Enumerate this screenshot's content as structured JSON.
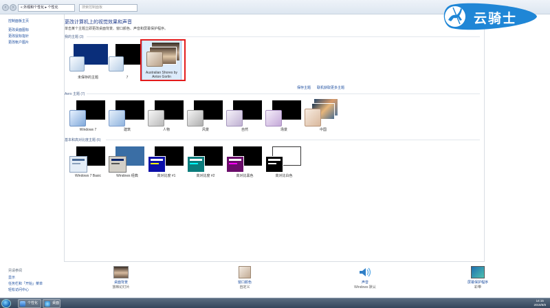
{
  "address": {
    "crumb": "« 外观和个性化 ▸ 个性化",
    "search_placeholder": "搜索控制面板"
  },
  "sidebar": {
    "links": [
      "控制面板主页",
      "更改桌面图标",
      "更改鼠标指针",
      "更改帐户图片"
    ],
    "see_also_title": "另请参阅",
    "see_also": [
      "显示",
      "任务栏和「开始」菜单",
      "轻松访问中心"
    ]
  },
  "main": {
    "title": "更改计算机上的视觉效果和声音",
    "subtitle": "单击某个主题立即更改桌面背景、窗口颜色、声音和屏幕保护程序。",
    "my_themes": {
      "header": "我的主题 (3)",
      "items": [
        "未保存的主题",
        "7",
        "Australian Shores by Anton Gorlin"
      ]
    },
    "save_theme_link": "保存主题",
    "online_link": "联机获取更多主题",
    "aero": {
      "header": "Aero 主题 (7)",
      "items": [
        "Windows 7",
        "建筑",
        "人物",
        "风景",
        "自然",
        "场景",
        "中国"
      ]
    },
    "basic": {
      "header": "基本和高对比度主题 (6)",
      "items": [
        "Windows 7 Basic",
        "Windows 经典",
        "高对比度 #1",
        "高对比度 #2",
        "高对比黑色",
        "高对比白色"
      ]
    }
  },
  "bottom": [
    {
      "label": "桌面背景",
      "value": "放映幻灯片"
    },
    {
      "label": "窗口颜色",
      "value": "自定义"
    },
    {
      "label": "声音",
      "value": "Windows 默认"
    },
    {
      "label": "屏幕保护程序",
      "value": "彩带"
    }
  ],
  "logo_text": "云骑士",
  "taskbar": {
    "items": [
      "个性化",
      "桌面"
    ],
    "time": "14:15",
    "date": "2019/8/8"
  }
}
